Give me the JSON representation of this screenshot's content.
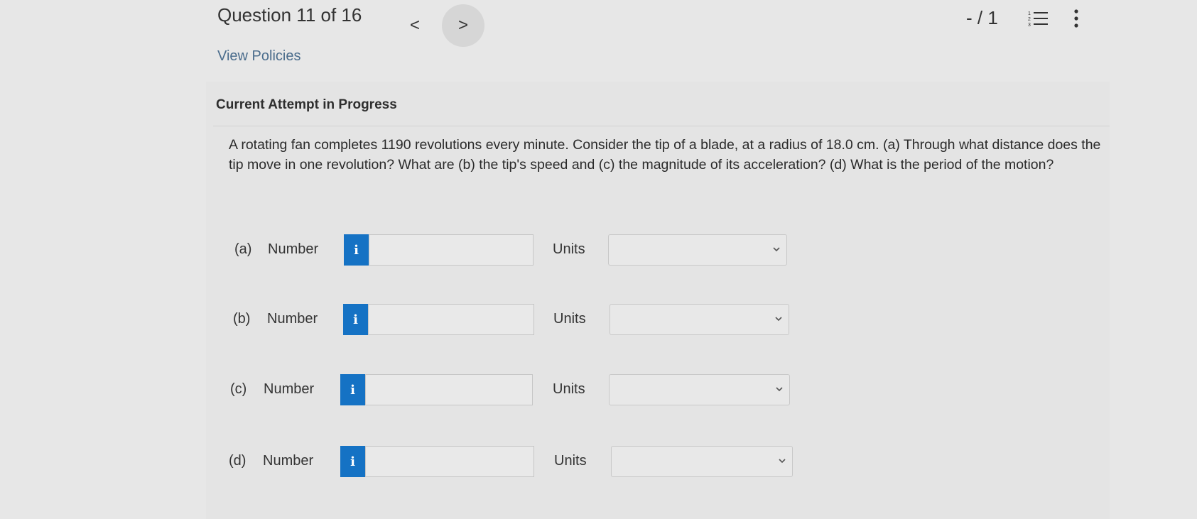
{
  "header": {
    "question_title": "Question 11 of 16",
    "prev_symbol": "<",
    "next_symbol": ">",
    "score": "- / 1"
  },
  "view_policies": "View Policies",
  "attempt_label": "Current Attempt in Progress",
  "question_text": "A rotating fan completes 1190 revolutions every minute. Consider the tip of a blade, at a radius of 18.0 cm. (a) Through what distance does the tip move in one revolution? What are (b) the tip's speed and (c) the magnitude of its acceleration? (d) What is the period of the motion?",
  "parts": [
    {
      "letter": "(a)",
      "number_label": "Number",
      "info_symbol": "i",
      "number_value": "",
      "units_label": "Units",
      "units_value": ""
    },
    {
      "letter": "(b)",
      "number_label": "Number",
      "info_symbol": "i",
      "number_value": "",
      "units_label": "Units",
      "units_value": ""
    },
    {
      "letter": "(c)",
      "number_label": "Number",
      "info_symbol": "i",
      "number_value": "",
      "units_label": "Units",
      "units_value": ""
    },
    {
      "letter": "(d)",
      "number_label": "Number",
      "info_symbol": "i",
      "number_value": "",
      "units_label": "Units",
      "units_value": ""
    }
  ],
  "icons": {
    "question_list": "list-icon",
    "more_options": "more-vertical-icon",
    "info": "info-icon",
    "dropdown": "chevron-down-icon"
  },
  "colors": {
    "info_button": "#1572c4",
    "link": "#4a6c8c",
    "background": "#e7e7e7"
  }
}
